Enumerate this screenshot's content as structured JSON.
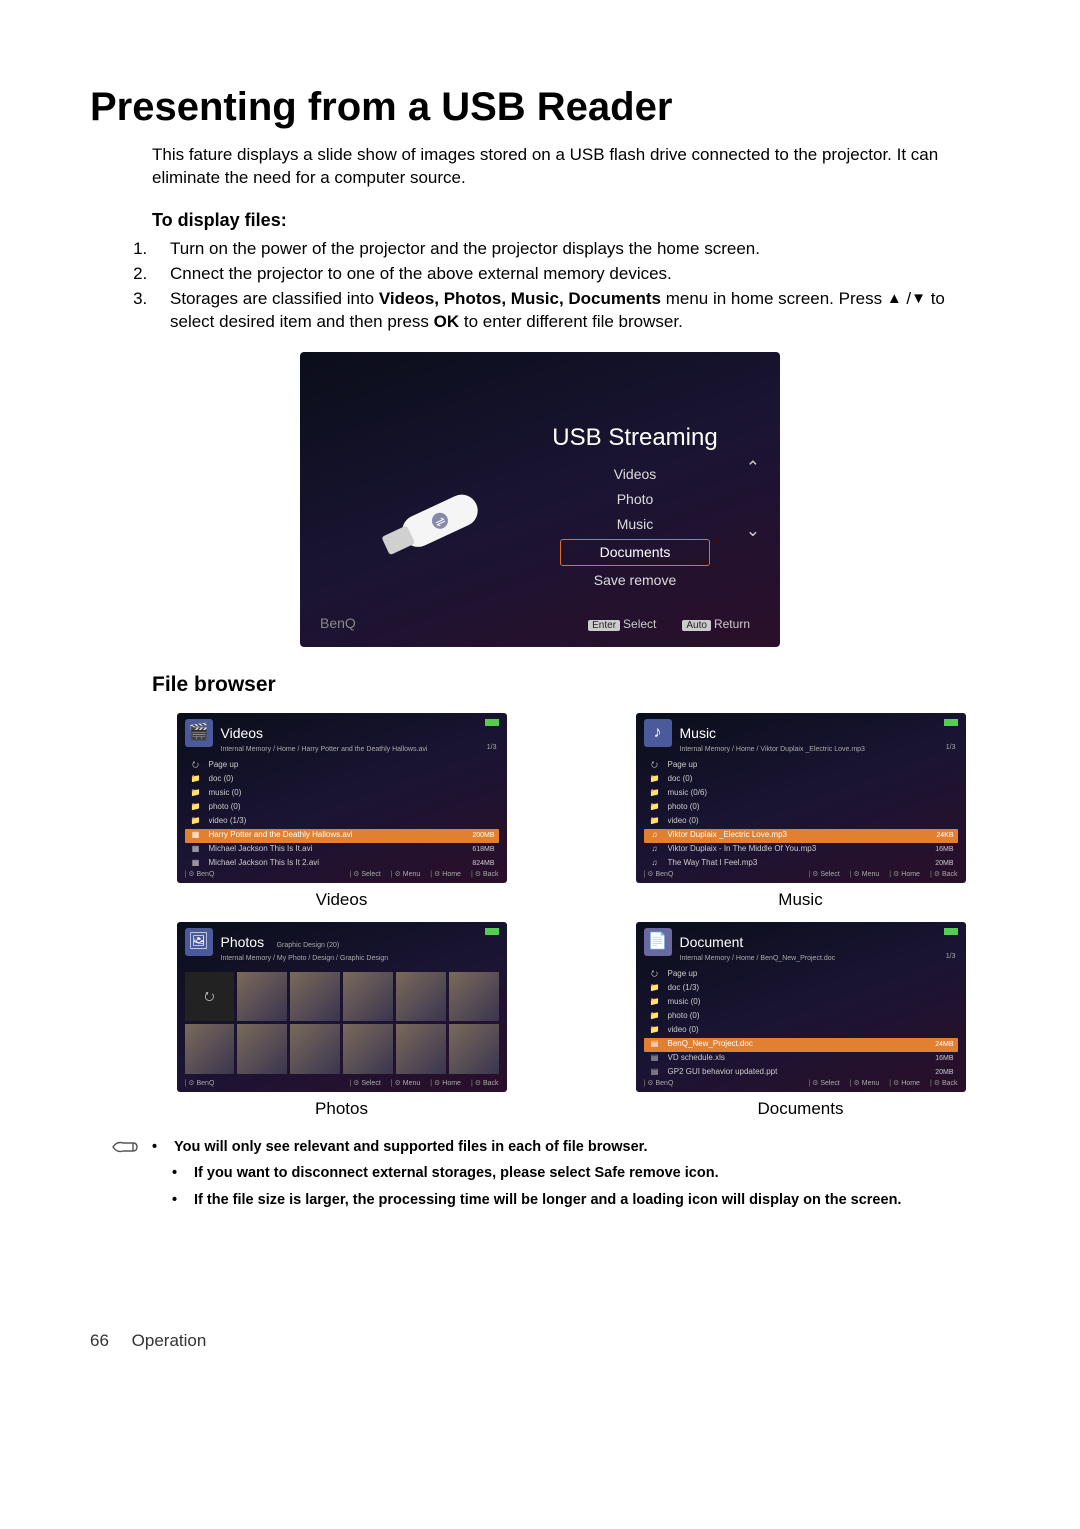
{
  "title": "Presenting from a USB Reader",
  "intro": "This fature displays a slide show of images stored on a USB flash drive connected to the projector. It can eliminate the need for a computer source.",
  "to_display_files": "To display files:",
  "steps": {
    "s1": "Turn on the power of the projector and the projector displays the home screen.",
    "s2": "Cnnect the projector to one of the above external memory devices.",
    "s3a": "Storages are classified into ",
    "s3b": "Videos, Photos, Music, Documents",
    "s3c": " menu in home screen. Press ",
    "s3d": " to select desired item and then press ",
    "s3e": "OK",
    "s3f": " to enter different file browser."
  },
  "main_shot": {
    "title": "USB Streaming",
    "items": [
      "Videos",
      "Photo",
      "Music",
      "Documents",
      "Save remove"
    ],
    "brand": "BenQ",
    "hint_select_key": "Enter",
    "hint_select": "Select",
    "hint_return_key": "Auto",
    "hint_return": "Return"
  },
  "file_browser_heading": "File browser",
  "brand_small": "BenQ",
  "footer_actions": {
    "a1": "Select",
    "a2": "Menu",
    "a3": "Home",
    "a4": "Back"
  },
  "page_indicator": "1/3",
  "videos": {
    "title": "Videos",
    "path": "Internal Memory / Home / Harry Potter and the Deathly Hallows.avi",
    "rows": [
      {
        "icon": "up",
        "label": "Page up",
        "size": ""
      },
      {
        "icon": "folder",
        "label": "doc (0)",
        "size": ""
      },
      {
        "icon": "folder",
        "label": "music (0)",
        "size": ""
      },
      {
        "icon": "folder",
        "label": "photo (0)",
        "size": ""
      },
      {
        "icon": "folder",
        "label": "video (1/3)",
        "size": ""
      },
      {
        "icon": "file",
        "label": "Harry Potter and the Deathly Hallows.avi",
        "size": "200MB",
        "hl": true
      },
      {
        "icon": "file",
        "label": "Michael Jackson This Is It.avi",
        "size": "618MB"
      },
      {
        "icon": "file",
        "label": "Michael Jackson This Is It 2.avi",
        "size": "824MB"
      }
    ],
    "caption": "Videos"
  },
  "music": {
    "title": "Music",
    "path": "Internal Memory / Home / Viktor Duplaix _Electric Love.mp3",
    "rows": [
      {
        "icon": "up",
        "label": "Page up",
        "size": ""
      },
      {
        "icon": "folder",
        "label": "doc (0)",
        "size": ""
      },
      {
        "icon": "folder",
        "label": "music (0/6)",
        "size": ""
      },
      {
        "icon": "folder",
        "label": "photo (0)",
        "size": ""
      },
      {
        "icon": "folder",
        "label": "video (0)",
        "size": ""
      },
      {
        "icon": "note",
        "label": "Viktor Duplaix _Electric Love.mp3",
        "size": "24KB",
        "hl": true
      },
      {
        "icon": "note",
        "label": "Viktor Duplaix - In The Middle Of You.mp3",
        "size": "16MB"
      },
      {
        "icon": "note",
        "label": "The Way That I Feel.mp3",
        "size": "20MB"
      }
    ],
    "caption": "Music"
  },
  "photos": {
    "title": "Photos",
    "subtitle": "Graphic Design (20)",
    "path": "Internal Memory / My Photo / Design / Graphic Design",
    "caption": "Photos"
  },
  "documents": {
    "title": "Document",
    "path": "Internal Memory / Home / BenQ_New_Project.doc",
    "rows": [
      {
        "icon": "up",
        "label": "Page up",
        "size": ""
      },
      {
        "icon": "folder",
        "label": "doc (1/3)",
        "size": ""
      },
      {
        "icon": "folder",
        "label": "music (0)",
        "size": ""
      },
      {
        "icon": "folder",
        "label": "photo (0)",
        "size": ""
      },
      {
        "icon": "folder",
        "label": "video (0)",
        "size": ""
      },
      {
        "icon": "doc",
        "label": "BenQ_New_Project.doc",
        "size": "24MB",
        "hl": true
      },
      {
        "icon": "doc",
        "label": "VD schedule.xls",
        "size": "16MB"
      },
      {
        "icon": "doc",
        "label": "GP2 GUI behavior updated.ppt",
        "size": "20MB"
      }
    ],
    "caption": "Documents"
  },
  "notes": {
    "n1": "You will only see relevant and supported files in each of file browser.",
    "n2": "If you want to disconnect external storages, please select Safe remove icon.",
    "n3": "If the file size is larger, the processing time will be longer and a loading icon will display on the screen."
  },
  "footer": {
    "page": "66",
    "section": "Operation"
  }
}
